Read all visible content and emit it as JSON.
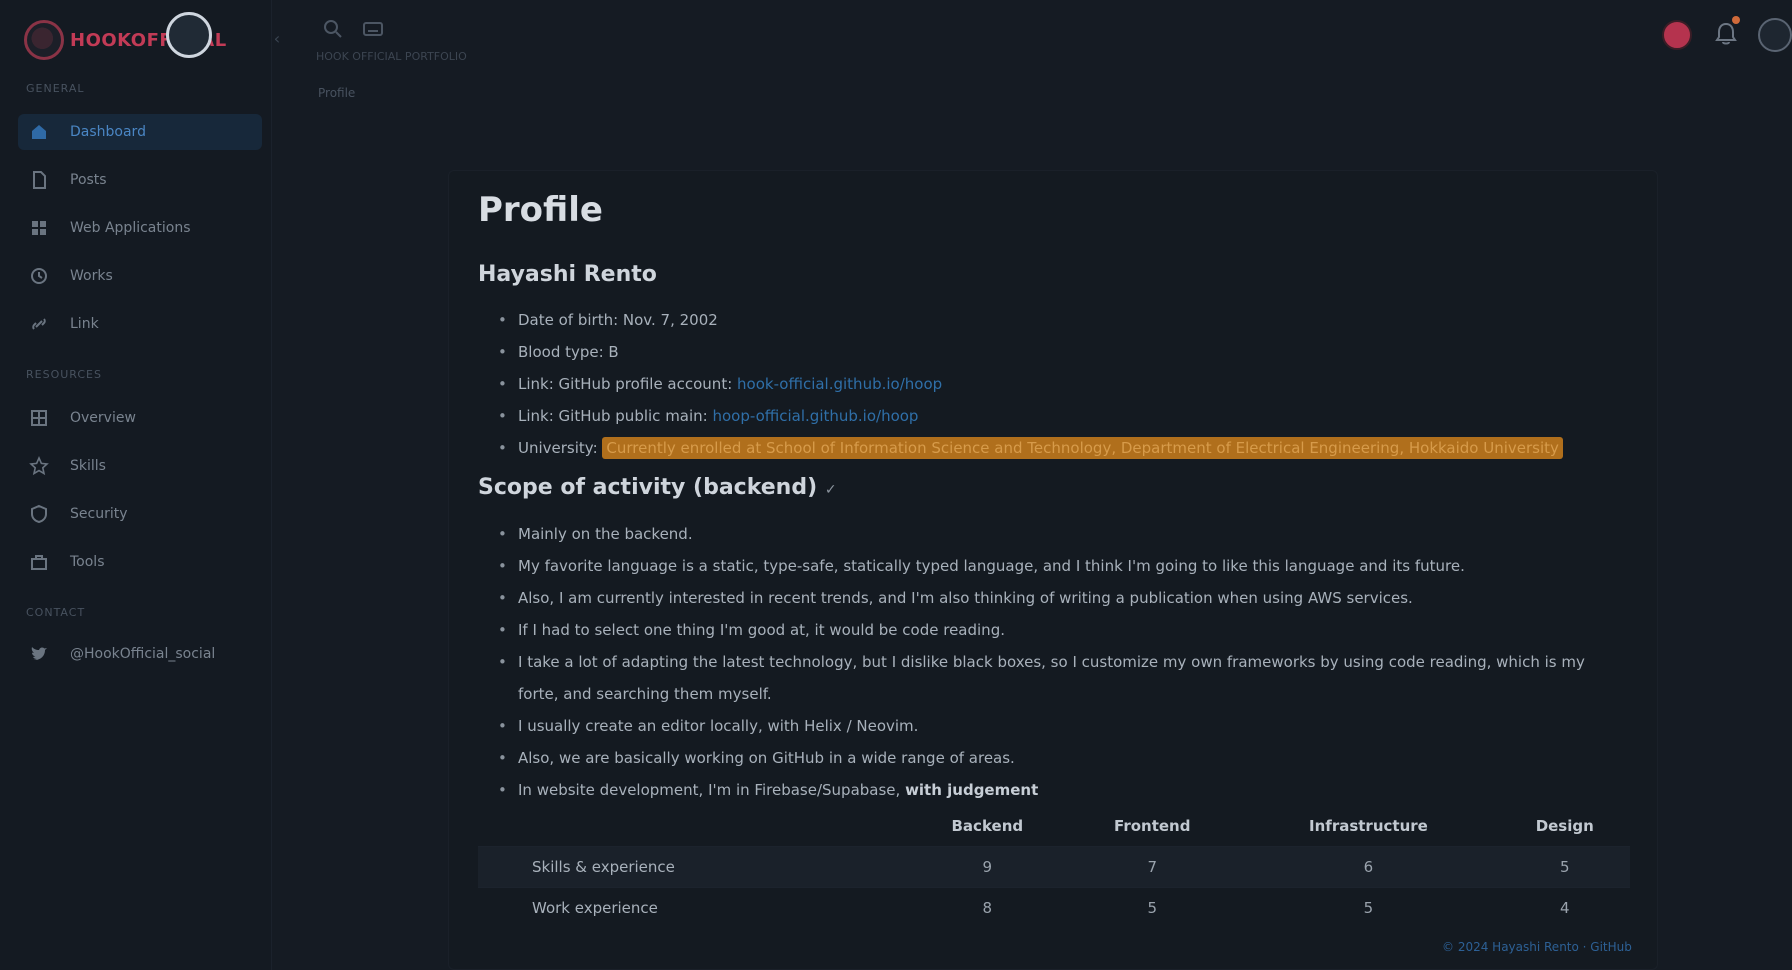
{
  "sidebar": {
    "logo_text": "HOOKOFFICIAL",
    "sections": [
      {
        "label": "GENERAL"
      },
      {
        "label": "RESOURCES"
      },
      {
        "label": "CONTACT"
      }
    ],
    "items": [
      {
        "label": "Dashboard",
        "icon": "home-icon"
      },
      {
        "label": "Posts",
        "icon": "document-icon"
      },
      {
        "label": "Web Applications",
        "icon": "apps-icon"
      },
      {
        "label": "Works",
        "icon": "clock-icon"
      },
      {
        "label": "Link",
        "icon": "link-icon"
      },
      {
        "label": "Overview",
        "icon": "grid-icon"
      },
      {
        "label": "Skills",
        "icon": "star-icon"
      },
      {
        "label": "Security",
        "icon": "shield-icon"
      },
      {
        "label": "Tools",
        "icon": "toolbox-icon"
      },
      {
        "label": "@HookOfficial_social",
        "icon": "twitter-icon"
      }
    ]
  },
  "topbar": {
    "subtitle": "HOOK OFFICIAL PORTFOLIO",
    "breadcrumb": "Profile"
  },
  "main": {
    "title": "Profile",
    "name": "Hayashi Rento",
    "info": [
      {
        "text": "Date of birth: Nov. 7, 2002"
      },
      {
        "text": "Blood type: B"
      },
      {
        "text": "Link: GitHub profile account: ",
        "link": "hook-official.github.io/hoop"
      },
      {
        "text": "Link: GitHub public main: ",
        "link": "hoop-official.github.io/hoop"
      },
      {
        "text": "University: ",
        "highlight": "Currently enrolled at School of Information Science and Technology, Department of Electrical Engineering, Hokkaido University"
      }
    ],
    "scope_title": "Scope of activity (backend)",
    "scope_mark": "✓",
    "scope_items": [
      {
        "text": "Mainly on the backend."
      },
      {
        "text": "My favorite language is a static, type-safe, statically typed language, and I think I'm going to like this language and its future."
      },
      {
        "text": "Also, I am currently interested in recent trends, and I'm also thinking of writing a publication when using AWS services."
      },
      {
        "text": "If I had to select one thing I'm good at, it would be code reading."
      },
      {
        "text": "I take a lot of adapting the latest technology, but I dislike black boxes, so I customize my own frameworks by using code reading, which is my forte, and searching them myself."
      },
      {
        "text": "I usually create an editor locally, with Helix / Neovim."
      },
      {
        "text": "Also, we are basically working on GitHub in a wide range of areas."
      },
      {
        "text": "In website development, I'm in Firebase/Supabase, ",
        "bold": "with judgement"
      }
    ],
    "table": {
      "headers": [
        "",
        "Backend",
        "Frontend",
        "Infrastructure",
        "Design"
      ],
      "rows": [
        [
          "Skills & experience",
          "9",
          "7",
          "6",
          "5"
        ],
        [
          "Work experience",
          "8",
          "5",
          "5",
          "4"
        ]
      ]
    },
    "footer_link": "© 2024 Hayashi Rento · GitHub"
  }
}
